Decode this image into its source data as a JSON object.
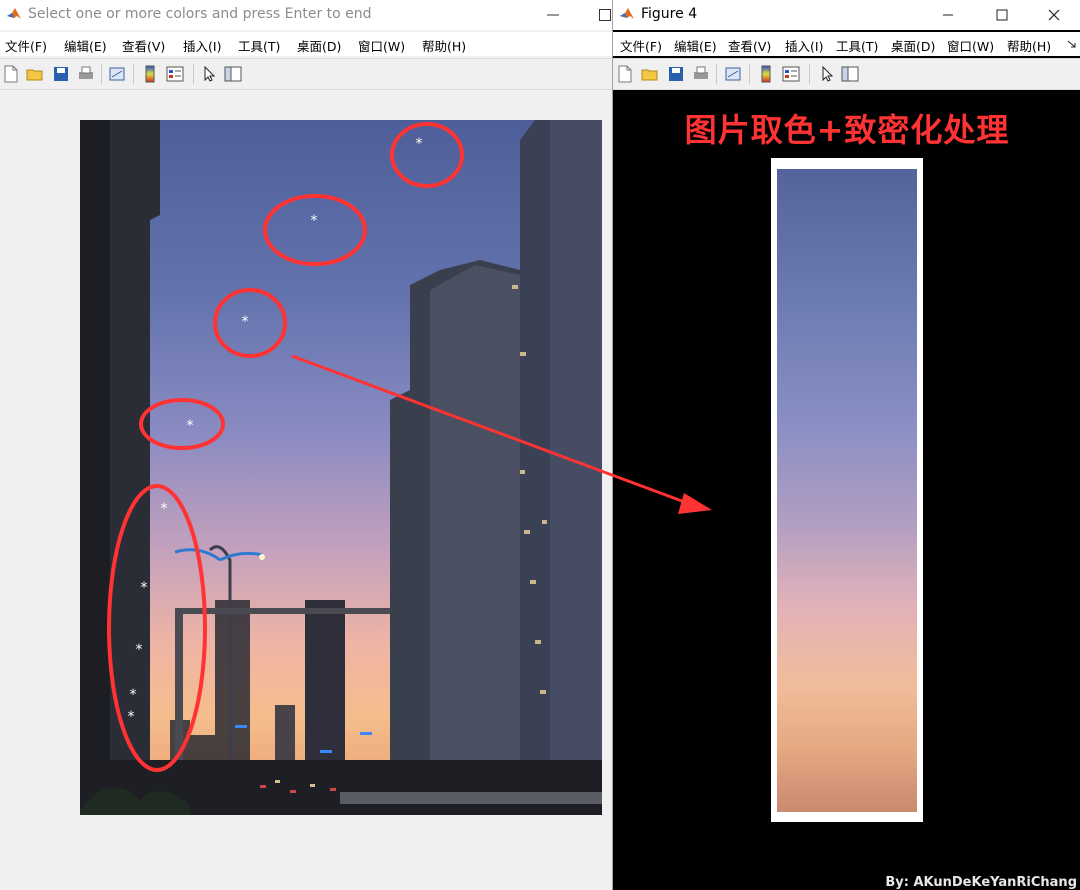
{
  "left_window": {
    "title": "Select one or more colors and press Enter to end",
    "menu": [
      "文件(F)",
      "编辑(E)",
      "查看(V)",
      "插入(I)",
      "工具(T)",
      "桌面(D)",
      "窗口(W)",
      "帮助(H)"
    ]
  },
  "right_window": {
    "title": "Figure 4",
    "menu": [
      "文件(F)",
      "编辑(E)",
      "查看(V)",
      "插入(I)",
      "工具(T)",
      "桌面(D)",
      "窗口(W)",
      "帮助(H)"
    ],
    "figure_title": "图片取色+致密化处理",
    "credit": "By: AKunDeKeYanRiChang"
  },
  "colors": {
    "annotation_red": "#ff3333",
    "sky_top": "#54639b",
    "sky_bottom": "#c98a6f"
  },
  "icons": {
    "app": "matlab-logo-icon",
    "toolbar": [
      "new-figure-icon",
      "open-file-icon",
      "save-icon",
      "print-icon",
      "link-plot-icon",
      "colorbar-icon",
      "legend-icon",
      "pointer-icon",
      "property-editor-icon"
    ]
  }
}
